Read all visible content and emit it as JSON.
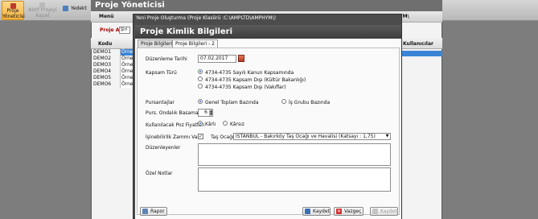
{
  "ribbon": {
    "buttons": [
      {
        "label_1": "Proje",
        "label_2": "Yöneticisi",
        "state": "active"
      },
      {
        "label_1": "Aktif Projeyi",
        "label_2": "Kapat",
        "state": "disabled"
      },
      {
        "label_1": "Yedekt",
        "state": "normal"
      }
    ]
  },
  "app": {
    "title": "Proje Yöneticisi",
    "menu_label": "Menü",
    "path_text": "TD\\AMPHYM\\",
    "search_label": "Proje Ara",
    "search_value": "Şirl",
    "grid": {
      "columns": [
        "Kodu",
        "Kullanıcılar"
      ],
      "rows": [
        {
          "kod": "DEMO1",
          "name": "Örnek",
          "selected": true
        },
        {
          "kod": "DEMO2",
          "name": "Örnek",
          "selected": false
        },
        {
          "kod": "DEMO3",
          "name": "Örnek",
          "selected": false
        },
        {
          "kod": "DEMO4",
          "name": "Örnek",
          "selected": false
        },
        {
          "kod": "DEMO5",
          "name": "Örnek",
          "selected": false
        },
        {
          "kod": "DEMO6",
          "name": "Örnek",
          "selected": false
        }
      ]
    }
  },
  "dialog": {
    "window_title": "Yeni Proje Oluşturma (Proje Klasörü :C:\\AMPLTD\\AMPHYM\\)",
    "header": "Proje Kimlik Bilgileri",
    "tabs": [
      {
        "label": "Proje Bilgileri - 1",
        "active": false
      },
      {
        "label": "Proje Bilgileri - 2",
        "active": true
      }
    ],
    "fields": {
      "duzenleme_tarihi": {
        "label": "Düzenleme Tarihi",
        "value": "07.02.2017"
      },
      "kapsam_turu": {
        "label": "Kapsam Türü",
        "options": [
          {
            "label": "4734-4735 Sayılı Kanun Kapsamında",
            "checked": true
          },
          {
            "label": "4734-4735 Kapsam Dışı (Kültür Bakanlığı)",
            "checked": false
          },
          {
            "label": "4734-4735 Kapsam Dışı (Vakıflar)",
            "checked": false
          }
        ]
      },
      "pursantajlar": {
        "label": "Pursantajlar",
        "options": [
          {
            "label": "Genel Toplam Bazında",
            "checked": true
          },
          {
            "label": "İş Grubu Bazında",
            "checked": false
          }
        ]
      },
      "ondalik": {
        "label": "Purs. Ondalık Basamak",
        "value": "6"
      },
      "poz_fiyatlari": {
        "label": "Kullanılacak Poz Fiyatları",
        "options": [
          {
            "label": "Kârlı",
            "checked": true
          },
          {
            "label": "Kârsız",
            "checked": false
          }
        ]
      },
      "isinebilirlik": {
        "label": "İşinebilirlik Zammı Var",
        "checked": true,
        "checkmark": "✓",
        "sub_label": "Taş Ocağı",
        "selected": "İSTANBUL - Bakırköy Taş Ocağı ve Havalisi (Katsayı : 1,75)"
      },
      "duzenleyenler": {
        "label": "Düzenleyenler",
        "value": ""
      },
      "ozel_notlar": {
        "label": "Özel Notlar",
        "value": ""
      }
    },
    "buttons": {
      "rapor": "Rapor",
      "kaydet": "Kaydet",
      "vazgec": "Vazgeç",
      "kaydet_disabled": "Kaydet"
    }
  }
}
